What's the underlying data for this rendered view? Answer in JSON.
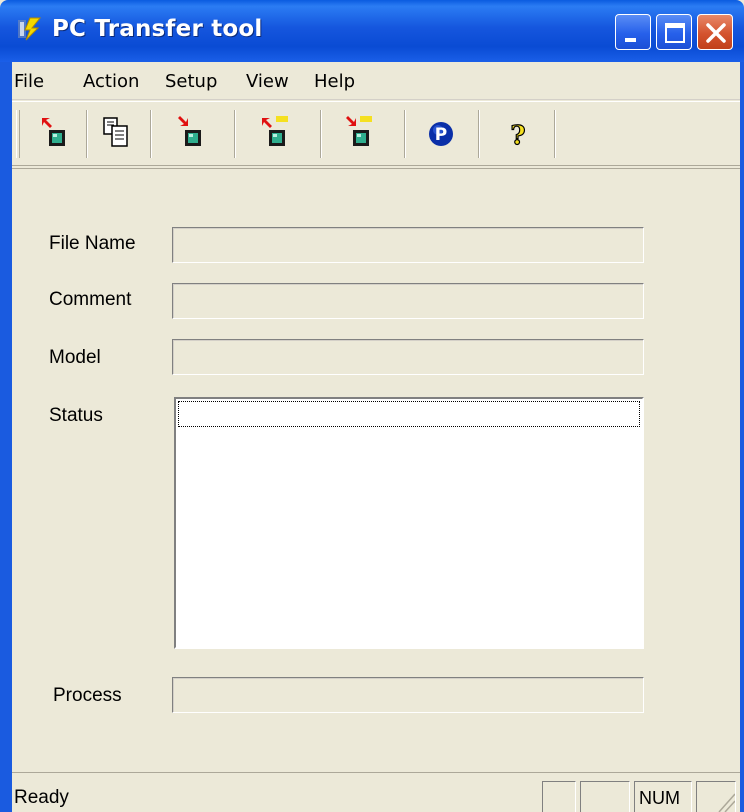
{
  "window": {
    "title": "PC Transfer tool",
    "colors": {
      "titlebar": "#1556de",
      "close_button": "#d4532e",
      "face": "#ece9d8"
    }
  },
  "menu": {
    "items": [
      {
        "label": "File"
      },
      {
        "label": "Action"
      },
      {
        "label": "Setup"
      },
      {
        "label": "View"
      },
      {
        "label": "Help"
      }
    ]
  },
  "toolbar": {
    "buttons": [
      {
        "icon": "send-to-device-icon"
      },
      {
        "icon": "copy-icon"
      },
      {
        "icon": "receive-from-device-icon"
      },
      {
        "icon": "send-all-to-device-icon"
      },
      {
        "icon": "receive-all-from-device-icon"
      },
      {
        "icon": "program-p-icon"
      },
      {
        "icon": "help-question-icon"
      }
    ]
  },
  "form": {
    "file_name_label": "File Name",
    "file_name_value": "",
    "comment_label": "Comment",
    "comment_value": "",
    "model_label": "Model",
    "model_value": "",
    "status_label": "Status",
    "status_value": "",
    "process_label": "Process",
    "process_value": ""
  },
  "statusbar": {
    "text": "Ready",
    "num_indicator": "NUM"
  }
}
